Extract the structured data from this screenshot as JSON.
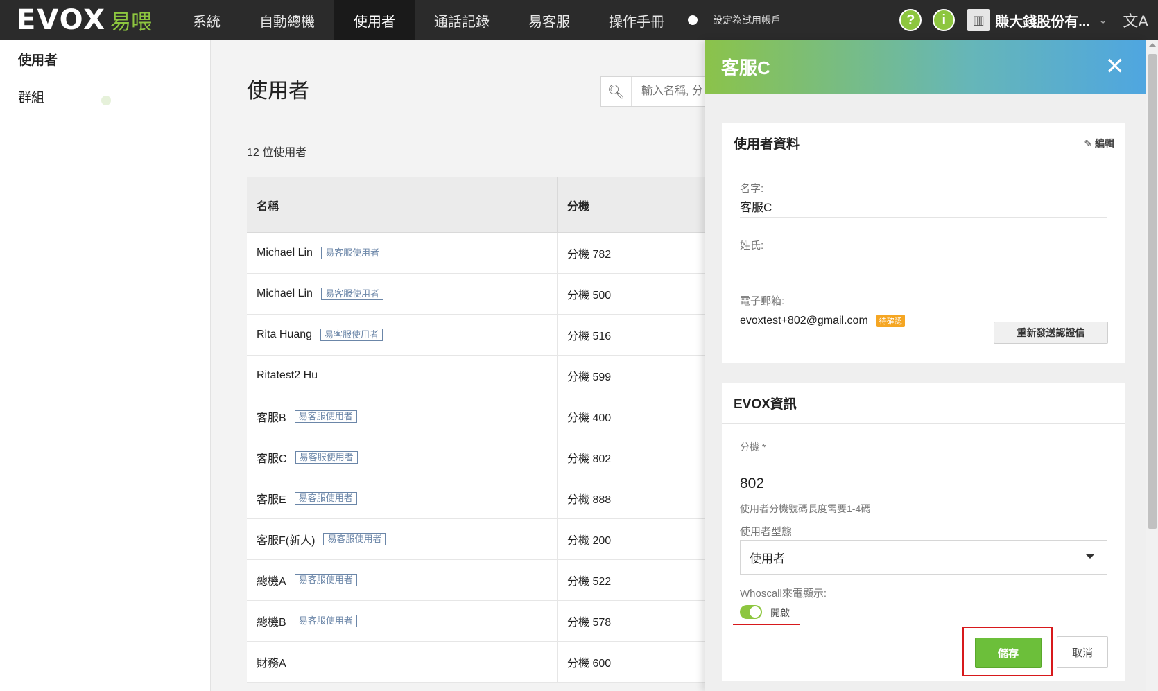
{
  "header": {
    "logo_text": "EVOX",
    "logo_cn": "易喂",
    "nav": [
      "系統",
      "自動總機",
      "使用者",
      "通話記錄",
      "易客服",
      "操作手冊"
    ],
    "active_nav": 2,
    "trial_text": "設定為試用帳戶",
    "help_icon": "?",
    "info_icon": "i",
    "company_name": "賺大錢股份有...",
    "chevron": "⌄",
    "lang_icon": "文A"
  },
  "sidebar": {
    "items": [
      "使用者",
      "群組"
    ]
  },
  "main": {
    "title": "使用者",
    "search_placeholder": "輸入名稱, 分",
    "count": "12 位使用者",
    "columns": [
      "名稱",
      "分機"
    ],
    "tag_label": "易客服使用者",
    "rows": [
      {
        "name": "Michael Lin",
        "tag": true,
        "ext": "分機 782"
      },
      {
        "name": "Michael Lin",
        "tag": true,
        "ext": "分機 500"
      },
      {
        "name": "Rita Huang",
        "tag": true,
        "ext": "分機 516"
      },
      {
        "name": "Ritatest2 Hu",
        "tag": false,
        "ext": "分機 599"
      },
      {
        "name": "客服B",
        "tag": true,
        "ext": "分機 400"
      },
      {
        "name": "客服C",
        "tag": true,
        "ext": "分機 802"
      },
      {
        "name": "客服E",
        "tag": true,
        "ext": "分機 888"
      },
      {
        "name": "客服F(新人)",
        "tag": true,
        "ext": "分機 200"
      },
      {
        "name": "總機A",
        "tag": true,
        "ext": "分機 522"
      },
      {
        "name": "總機B",
        "tag": true,
        "ext": "分機 578"
      },
      {
        "name": "財務A",
        "tag": false,
        "ext": "分機 600"
      }
    ]
  },
  "panel": {
    "title": "客服C",
    "close": "✕",
    "user_info": {
      "heading": "使用者資料",
      "edit_label": "編輯",
      "first_name_label": "名字:",
      "first_name": "客服C",
      "last_name_label": "姓氏:",
      "last_name": "",
      "email_label": "電子郵箱:",
      "email": "evoxtest+802@gmail.com",
      "email_badge": "待確認",
      "resend_label": "重新發送認證信"
    },
    "evox_info": {
      "heading": "EVOX資訊",
      "ext_label": "分機 *",
      "ext_value": "802",
      "ext_hint": "使用者分機號碼長度需要1-4碼",
      "type_label": "使用者型態",
      "type_value": "使用者",
      "whoscall_label": "Whoscall來電顯示:",
      "whoscall_state": "開啟",
      "save_label": "儲存",
      "cancel_label": "取消"
    }
  },
  "colors": {
    "accent_green": "#8dc63f",
    "highlight_red": "#d7191c"
  }
}
